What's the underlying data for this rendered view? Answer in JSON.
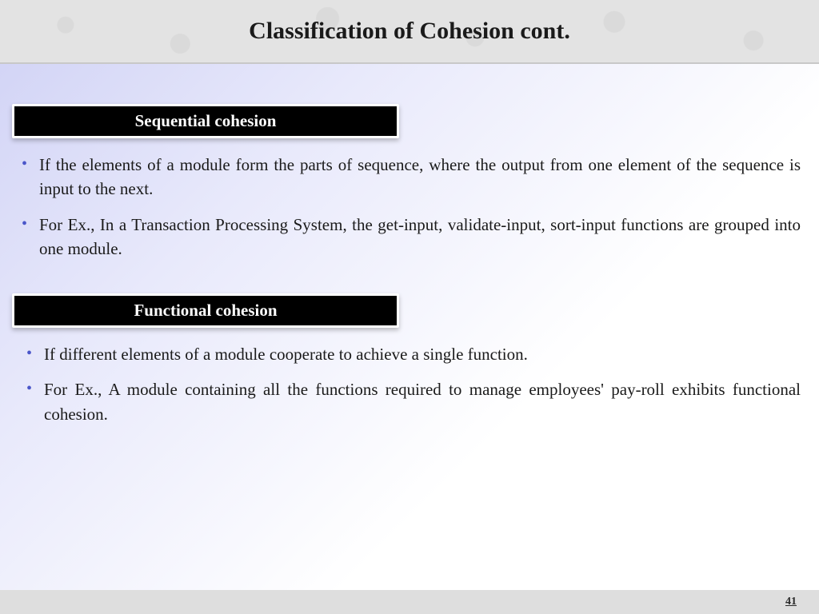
{
  "header": {
    "title": "Classification of Cohesion cont."
  },
  "sections": [
    {
      "heading": "Sequential cohesion",
      "bullets": [
        "If the elements of a module form the parts of sequence, where the output from one element of the sequence is input to the next.",
        "For Ex., In a Transaction Processing System, the get-input, validate-input, sort-input functions are grouped into one module."
      ]
    },
    {
      "heading": "Functional cohesion",
      "bullets": [
        "If different elements of a module cooperate to achieve a single function.",
        "For Ex., A module containing all the functions required to manage employees' pay-roll exhibits functional cohesion."
      ]
    }
  ],
  "footer": {
    "page_number": "41"
  }
}
